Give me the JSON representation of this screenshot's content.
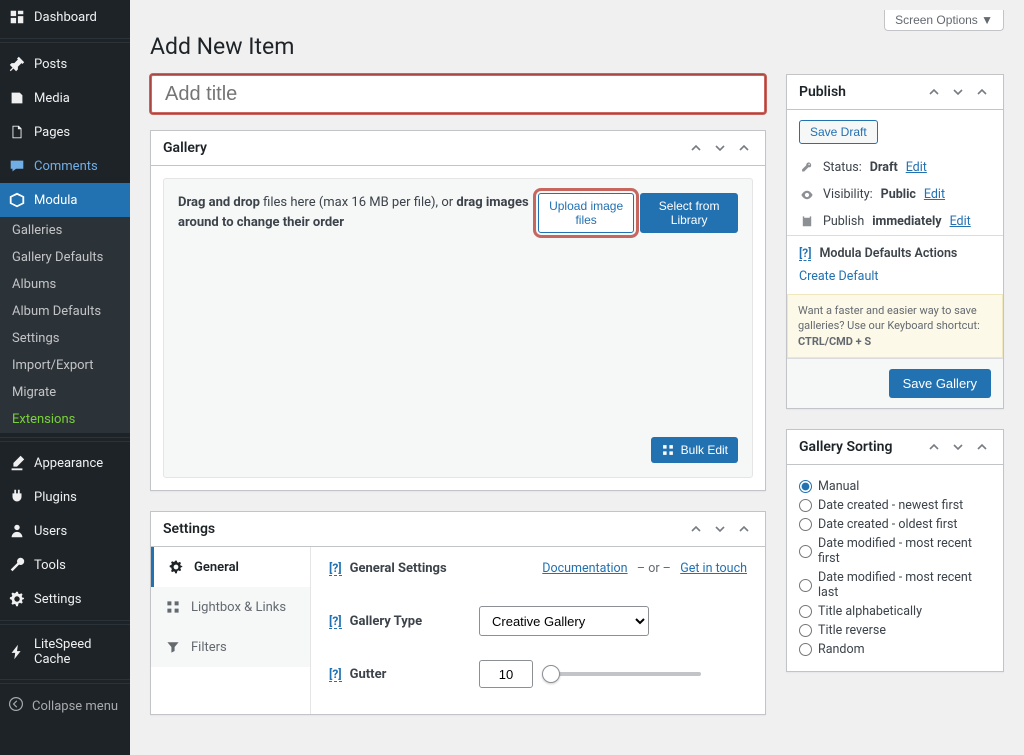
{
  "screen_options": "Screen Options ▼",
  "page_title": "Add New Item",
  "title_placeholder": "Add title",
  "sidebar": {
    "items": [
      {
        "label": "Dashboard",
        "icon": "dashboard"
      },
      {
        "label": "Posts",
        "icon": "pin"
      },
      {
        "label": "Media",
        "icon": "media"
      },
      {
        "label": "Pages",
        "icon": "page"
      },
      {
        "label": "Comments",
        "icon": "comment"
      },
      {
        "label": "Modula",
        "icon": "modula"
      }
    ],
    "submenu": [
      "Galleries",
      "Gallery Defaults",
      "Albums",
      "Album Defaults",
      "Settings",
      "Import/Export",
      "Migrate",
      "Extensions"
    ],
    "lower": [
      {
        "label": "Appearance",
        "icon": "brush"
      },
      {
        "label": "Plugins",
        "icon": "plug"
      },
      {
        "label": "Users",
        "icon": "user"
      },
      {
        "label": "Tools",
        "icon": "wrench"
      },
      {
        "label": "Settings",
        "icon": "gear"
      },
      {
        "label": "LiteSpeed Cache",
        "icon": "bolt"
      }
    ],
    "collapse": "Collapse menu"
  },
  "gallery_box": {
    "title": "Gallery",
    "instruction_prefix": "Drag and drop",
    "instruction_mid": " files here (max 16 MB per file), or ",
    "instruction_bold2": "drag images around to change their order",
    "upload_btn": "Upload image files",
    "select_btn": "Select from Library",
    "bulk_edit": "Bulk Edit"
  },
  "settings_box": {
    "title": "Settings",
    "tabs": [
      {
        "label": "General",
        "icon": "gear"
      },
      {
        "label": "Lightbox & Links",
        "icon": "grid"
      },
      {
        "label": "Filters",
        "icon": "filter"
      }
    ],
    "section_title": "General Settings",
    "links": {
      "docs": "Documentation",
      "or": "– or –",
      "touch": "Get in touch"
    },
    "rows": {
      "type_label": "Gallery Type",
      "type_value": "Creative Gallery",
      "gutter_label": "Gutter",
      "gutter_value": "10"
    },
    "help": "[?]"
  },
  "publish_box": {
    "title": "Publish",
    "save_draft": "Save Draft",
    "status_label": "Status:",
    "status_value": "Draft",
    "visibility_label": "Visibility:",
    "visibility_value": "Public",
    "publish_label": "Publish",
    "publish_value": "immediately",
    "edit": "Edit",
    "defaults_title": "Modula Defaults Actions",
    "create_default": "Create Default",
    "tip_prefix": "Want a faster and easier way to save galleries? Use our Keyboard shortcut: ",
    "tip_shortcut": "CTRL/CMD + S",
    "save_gallery": "Save Gallery",
    "help": "[?]"
  },
  "sorting_box": {
    "title": "Gallery Sorting",
    "options": [
      "Manual",
      "Date created - newest first",
      "Date created - oldest first",
      "Date modified - most recent first",
      "Date modified - most recent last",
      "Title alphabetically",
      "Title reverse",
      "Random"
    ]
  }
}
